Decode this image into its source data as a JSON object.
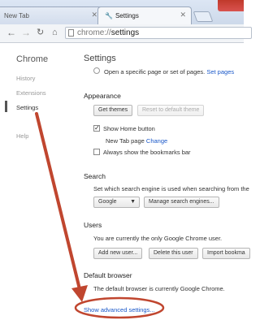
{
  "tabs": [
    {
      "label": "New Tab",
      "active": false
    },
    {
      "label": "Settings",
      "active": true
    }
  ],
  "toolbar": {
    "url_scheme": "chrome://",
    "url_path": "settings"
  },
  "sidebar": {
    "title": "Chrome",
    "items": [
      {
        "label": "History"
      },
      {
        "label": "Extensions"
      },
      {
        "label": "Settings"
      },
      {
        "label": "Help"
      }
    ]
  },
  "settings": {
    "title": "Settings",
    "startup": {
      "radio_label": "Open a specific page or set of pages.",
      "link": "Set pages"
    },
    "appearance": {
      "heading": "Appearance",
      "get_themes": "Get themes",
      "reset_theme": "Reset to default theme",
      "show_home": "Show Home button",
      "new_tab_page": "New Tab page",
      "change": "Change",
      "bookmarks_bar": "Always show the bookmarks bar"
    },
    "search": {
      "heading": "Search",
      "description": "Set which search engine is used when searching from the",
      "engine": "Google",
      "manage": "Manage search engines..."
    },
    "users": {
      "heading": "Users",
      "description": "You are currently the only Google Chrome user.",
      "add": "Add new user...",
      "delete": "Delete this user",
      "import": "Import bookma"
    },
    "default_browser": {
      "heading": "Default browser",
      "description": "The default browser is currently Google Chrome."
    },
    "advanced_link": "Show advanced settings..."
  },
  "colors": {
    "annotation": "#c0462f",
    "link": "#1a58c9"
  }
}
